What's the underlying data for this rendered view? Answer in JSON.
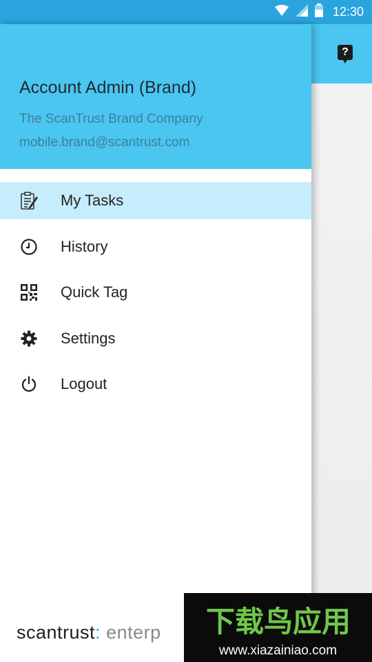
{
  "status_bar": {
    "time": "12:30"
  },
  "drawer": {
    "account_name": "Account Admin (Brand)",
    "company": "The ScanTrust Brand Company",
    "email": "mobile.brand@scantrust.com",
    "menu": [
      {
        "label": "My Tasks",
        "icon": "tasks-icon",
        "active": true
      },
      {
        "label": "History",
        "icon": "clock-icon",
        "active": false
      },
      {
        "label": "Quick Tag",
        "icon": "qr-code-icon",
        "active": false
      },
      {
        "label": "Settings",
        "icon": "gear-icon",
        "active": false
      },
      {
        "label": "Logout",
        "icon": "power-icon",
        "active": false
      }
    ],
    "footer": {
      "brand": "scantrust",
      "colon": ":",
      "suffix": " enterp"
    }
  },
  "app_bar": {
    "help_symbol": "?"
  },
  "watermark": {
    "url": "www.xiazainiao.com",
    "logo_text": "下载鸟应用"
  },
  "colors": {
    "header": "#4ac6f1",
    "status_bar": "#2aa4dd",
    "active_item": "#c6edfb"
  }
}
